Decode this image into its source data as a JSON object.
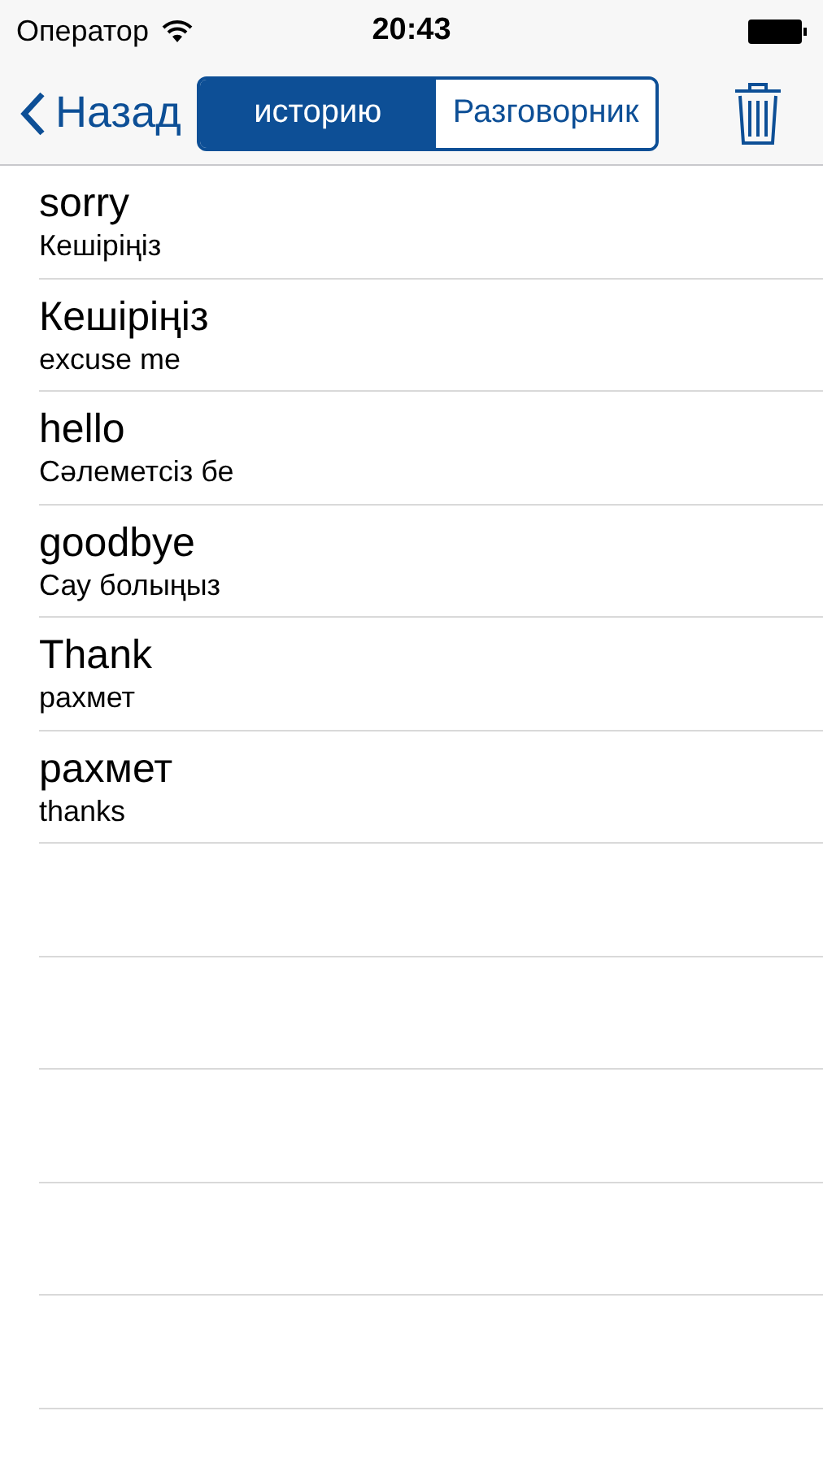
{
  "status_bar": {
    "carrier": "Оператор",
    "time": "20:43"
  },
  "nav_bar": {
    "back": "Назад",
    "segments": [
      {
        "label": "историю",
        "selected": true
      },
      {
        "label": "Разговорник",
        "selected": false
      }
    ]
  },
  "items": [
    {
      "title": "sorry",
      "subtitle": "Кешіріңіз"
    },
    {
      "title": "Кешіріңіз",
      "subtitle": "excuse me"
    },
    {
      "title": "hello",
      "subtitle": "Сәлеметсіз бе"
    },
    {
      "title": "goodbye",
      "subtitle": "Сау болыңыз"
    },
    {
      "title": "Thank",
      "subtitle": "рахмет"
    },
    {
      "title": "рахмет",
      "subtitle": "thanks"
    }
  ]
}
